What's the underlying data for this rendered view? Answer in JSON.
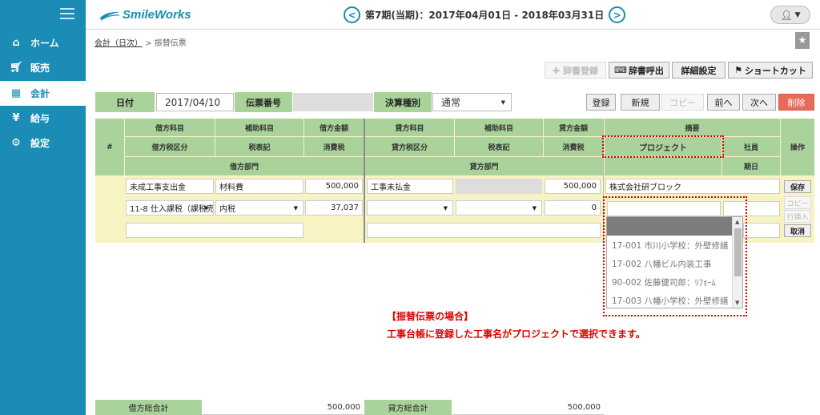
{
  "sidebar": {
    "items": [
      {
        "label": "ホーム",
        "icon": "home-icon"
      },
      {
        "label": "販売",
        "icon": "cart-icon"
      },
      {
        "label": "会計",
        "icon": "calculator-icon"
      },
      {
        "label": "給与",
        "icon": "money-bag-icon"
      },
      {
        "label": "設定",
        "icon": "gear-icon"
      }
    ]
  },
  "header": {
    "logo": "SmileWorks",
    "period": "第7期(当期)：2017年04月01日 - 2018年03月31日"
  },
  "breadcrumb": {
    "parent": "会計（日次）",
    "sep": ">",
    "current": "振替伝票"
  },
  "toolbar": {
    "dict_register": "✚ 辞書登録",
    "dict_call": "辞書呼出",
    "detail_settings": "詳細設定",
    "shortcut": "ショートカット"
  },
  "form": {
    "date_label": "日付",
    "date_value": "2017/04/10",
    "slip_no_label": "伝票番号",
    "settlement_label": "決算種別",
    "settlement_value": "通常"
  },
  "actions": {
    "register": "登録",
    "new": "新規",
    "copy": "コピー",
    "prev": "前へ",
    "next": "次へ",
    "delete": "削除"
  },
  "grid": {
    "headers": {
      "num": "#",
      "debit_account": "借方科目",
      "debit_sub": "補助科目",
      "debit_amount": "借方金額",
      "debit_tax_class": "借方税区分",
      "tax_note1": "税表記",
      "tax1": "消費税",
      "debit_dept": "借方部門",
      "credit_account": "貸方科目",
      "credit_sub": "補助科目",
      "credit_amount": "貸方金額",
      "credit_tax_class": "貸方税区分",
      "tax_note2": "税表記",
      "tax2": "消費税",
      "credit_dept": "貸方部門",
      "summary": "摘要",
      "project": "プロジェクト",
      "employee": "社員",
      "due": "期日",
      "ops": "操作"
    },
    "row": {
      "debit_account": "未成工事支出金",
      "debit_sub": "材料費",
      "debit_amount": "500,000",
      "debit_tax_class": "11-8 仕入課税（課税売",
      "debit_tax_note": "内税",
      "debit_tax": "37,037",
      "credit_account": "工事未払金",
      "credit_amount": "500,000",
      "credit_tax": "0",
      "summary": "株式会社研ブロック"
    },
    "row_buttons": {
      "save": "保存",
      "copy": "コピー",
      "insert": "行挿入",
      "cancel": "取消"
    }
  },
  "dropdown": {
    "options": [
      "17-001 市川小学校：外壁修繕",
      "17-002 八幡ビル内装工事",
      "90-002 佐藤健司郎：ﾘﾌｫｰﾑ",
      "17-003 八幡小学校：外壁修繕"
    ]
  },
  "annotation": {
    "line1": "【振替伝票の場合】",
    "line2": "工事台帳に登録した工事名がプロジェクトで選択できます。"
  },
  "totals": {
    "debit_label": "借方総合計",
    "debit_value": "500,000",
    "credit_label": "貸方総合計",
    "credit_value": "500,000"
  },
  "colors": {
    "sidebar": "#1a8cb5",
    "header_green": "#a9d39a",
    "grid_bg": "#f8f3c2",
    "highlight": "#d90000"
  }
}
